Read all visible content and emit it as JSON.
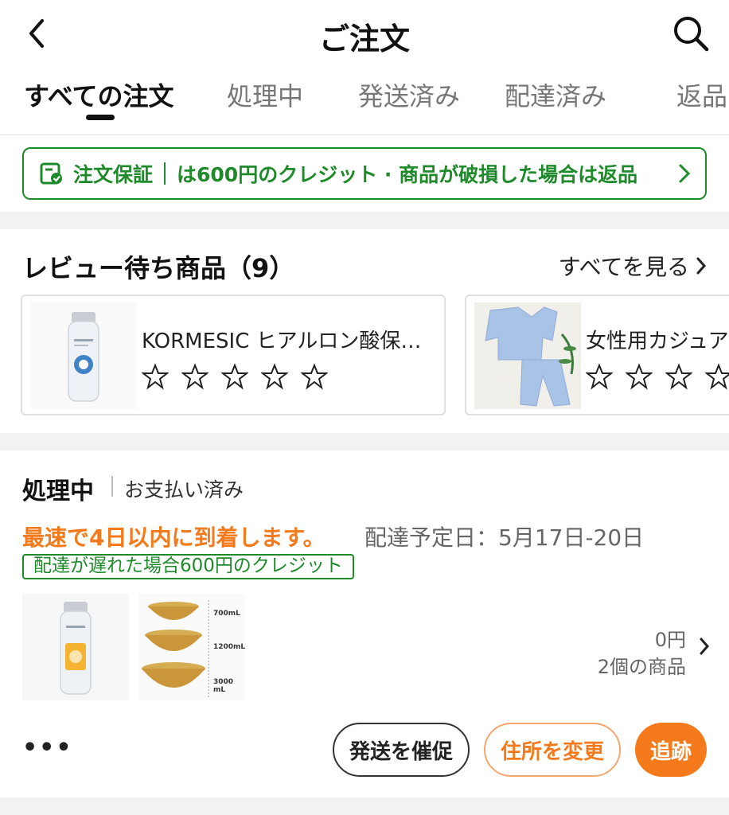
{
  "header": {
    "title": "ご注文",
    "back_icon": "chevron-left-icon",
    "search_icon": "search-icon"
  },
  "tabs": [
    {
      "label": "すべての注文",
      "active": true
    },
    {
      "label": "処理中",
      "active": false
    },
    {
      "label": "発送済み",
      "active": false
    },
    {
      "label": "配達済み",
      "active": false
    },
    {
      "label": "返品",
      "active": false
    }
  ],
  "guarantee": {
    "title": "注文保証",
    "text": "は600円のクレジット · 商品が破損した場合は返品",
    "color": "#1f8a2a"
  },
  "reviews": {
    "title": "レビュー待ち商品（9）",
    "see_all": "すべてを見る",
    "items": [
      {
        "name": "KORMESIC ヒアルロン酸保…",
        "stars": 0
      },
      {
        "name": "女性用カジュア",
        "stars": 0
      }
    ]
  },
  "order": {
    "status": "処理中",
    "payment": "お支払い済み",
    "eta_fast": "最速で4日以内に到着します。",
    "eta_date": "配達予定日：5月17日-20日",
    "late_credit": "配達が遅れた場合600円のクレジット",
    "bowl_sizes": [
      "700mL",
      "1200mL",
      "3000 mL"
    ],
    "price": "0円",
    "count": "2個の商品",
    "more": "•••",
    "buttons": {
      "remind": "発送を催促",
      "address": "住所を変更",
      "track": "追跡"
    },
    "accent": "#f57a1c"
  }
}
